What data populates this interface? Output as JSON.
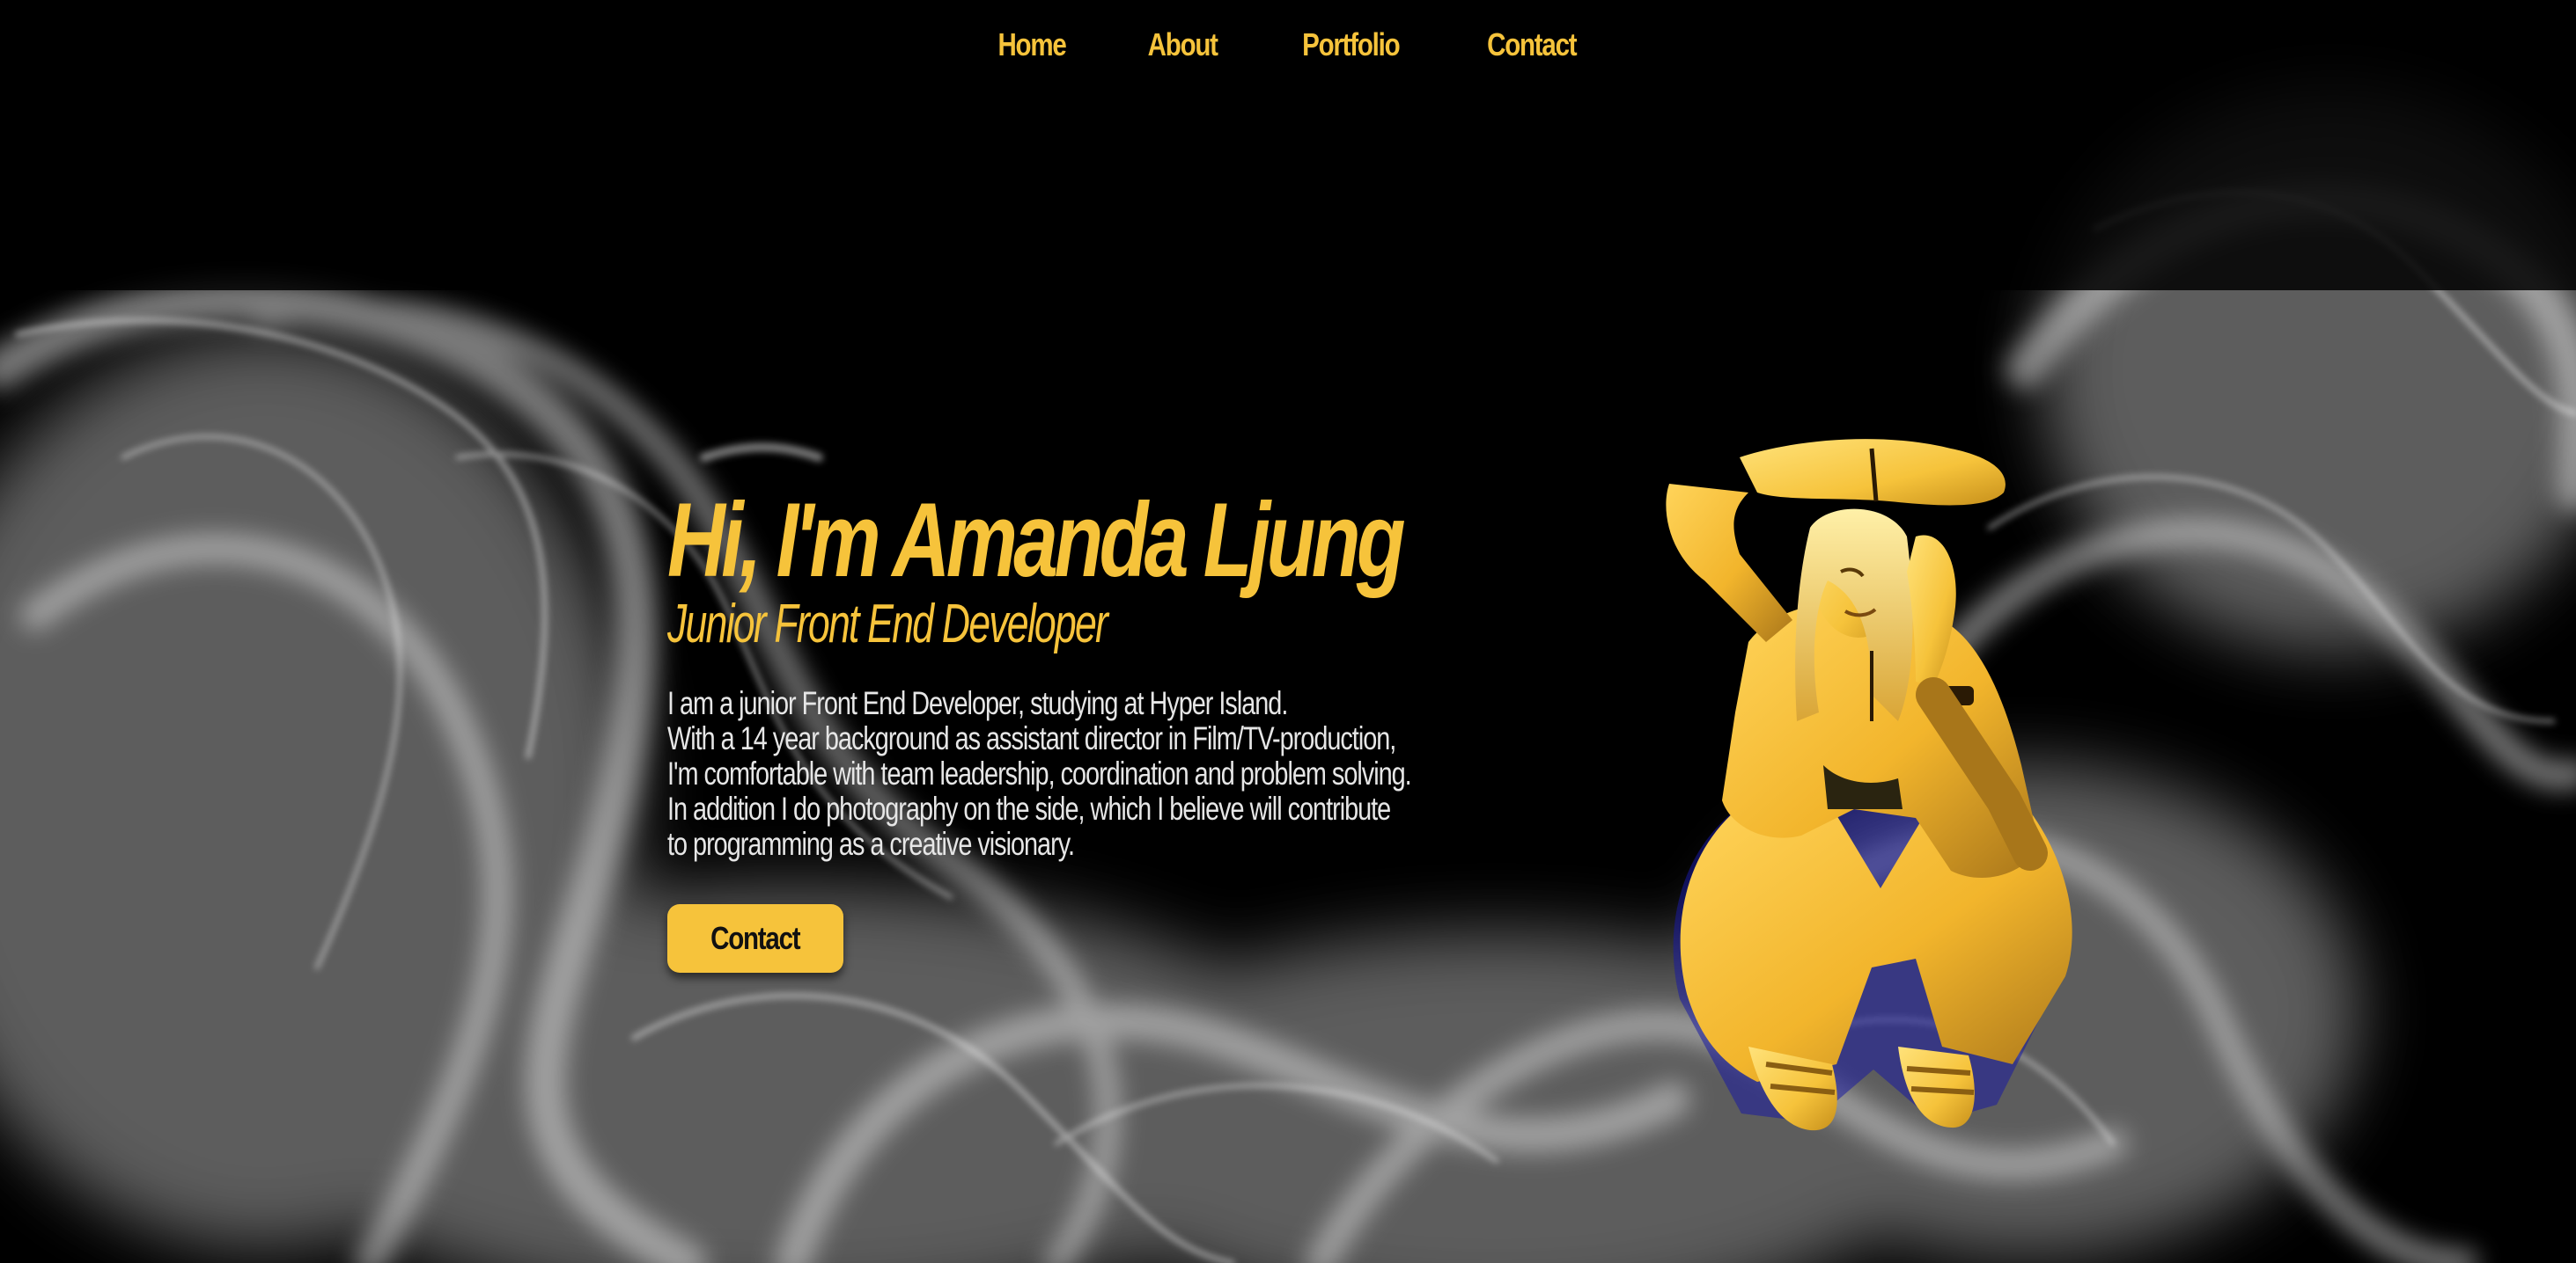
{
  "nav": {
    "items": [
      {
        "label": "Home"
      },
      {
        "label": "About"
      },
      {
        "label": "Portfolio"
      },
      {
        "label": "Contact"
      }
    ]
  },
  "hero": {
    "heading": "Hi, I'm Amanda Ljung",
    "subheading": "Junior Front End Developer",
    "bio_lines": [
      "I am a junior Front End Developer, studying at Hyper Island.",
      "With a 14 year background as assistant director in Film/TV-production,",
      "I'm comfortable with team leadership, coordination and problem solving.",
      "In addition I do photography on the side, which I believe will contribute",
      "to programming as a creative visionary."
    ],
    "cta_label": "Contact"
  },
  "colors": {
    "accent": "#f6c33b",
    "background": "#000000",
    "body_text": "#e6e6e6"
  },
  "icons": {
    "background": "smoke-background-image",
    "portrait": "amanda-portrait-photo"
  }
}
